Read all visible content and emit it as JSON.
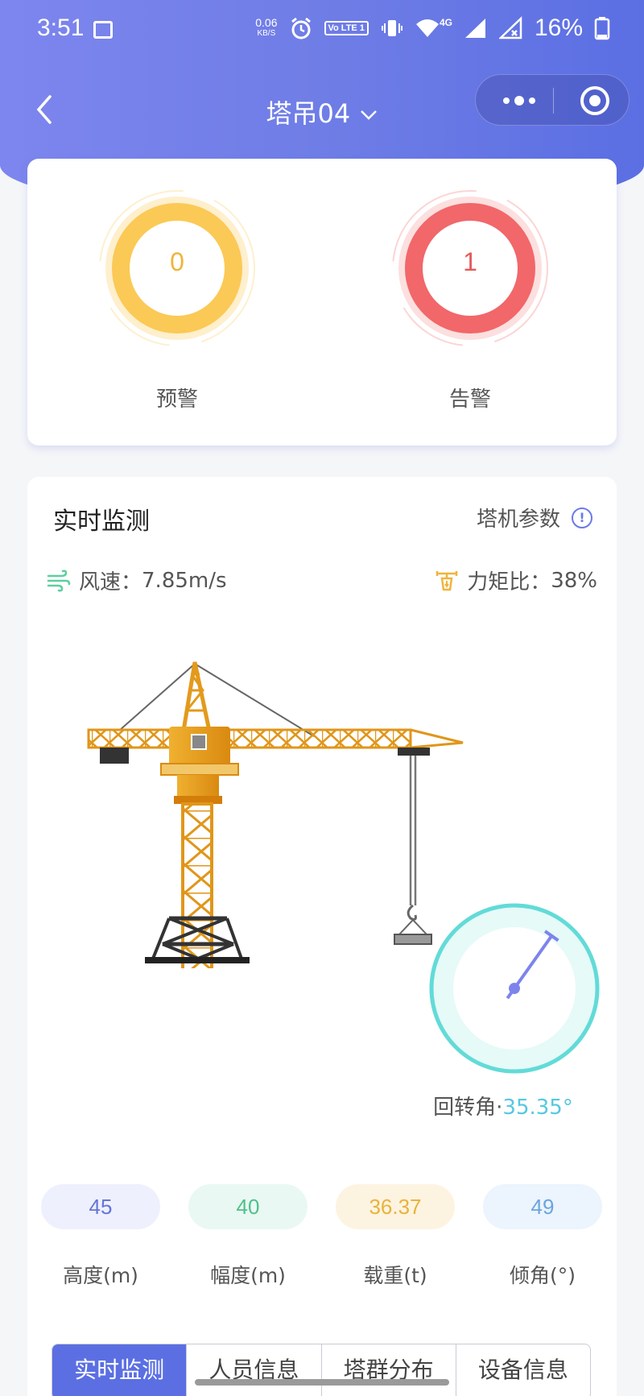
{
  "status_bar": {
    "time": "3:51",
    "net_speed_value": "0.06",
    "net_speed_unit": "KB/S",
    "volte_label": "Vo LTE 1",
    "signal_label": "4G",
    "battery": "16%"
  },
  "nav": {
    "title": "塔吊04",
    "back_icon": "chevron-left-icon",
    "dropdown_icon": "chevron-down-icon"
  },
  "alarm": {
    "warning": {
      "value": "0",
      "label": "预警",
      "color": "#f7b731"
    },
    "alert": {
      "value": "1",
      "label": "告警",
      "color": "#f15b5b"
    }
  },
  "monitor": {
    "title": "实时监测",
    "params_label": "塔机参数",
    "wind_label": "风速：",
    "wind_value": "7.85m/s",
    "torque_label": "力矩比：",
    "torque_value": "38%",
    "rotation_label": "回转角·",
    "rotation_value": "35.35°",
    "rotation_angle_deg": 35.35
  },
  "stats": [
    {
      "value": "45",
      "label": "高度(m)",
      "bg": "#eef0fd",
      "color": "#6674d8"
    },
    {
      "value": "40",
      "label": "幅度(m)",
      "bg": "#e9f8f2",
      "color": "#4fc08d"
    },
    {
      "value": "36.37",
      "label": "载重(t)",
      "bg": "#fdf3e1",
      "color": "#e8b33a"
    },
    {
      "value": "49",
      "label": "倾角(°)",
      "bg": "#ecf4fd",
      "color": "#6aa5e0"
    }
  ],
  "tabs": [
    {
      "label": "实时监测",
      "active": true
    },
    {
      "label": "人员信息",
      "active": false
    },
    {
      "label": "塔群分布",
      "active": false
    },
    {
      "label": "设备信息",
      "active": false
    }
  ]
}
